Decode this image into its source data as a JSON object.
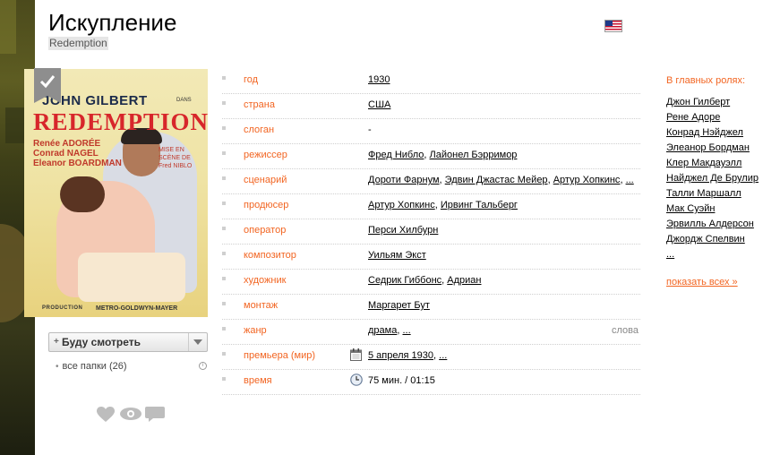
{
  "film": {
    "title": "Искупление",
    "original_title": "Redemption",
    "flag_icon": "us-flag-icon"
  },
  "poster": {
    "john": "JOHN GILBERT",
    "dans": "DANS",
    "title": "REDEMPTION",
    "cast_lines": [
      "Renée  ADORÉE",
      "Conrad  NAGEL",
      "Eleanor BOARDMAN"
    ],
    "mise": "MISE EN SCÈNE DE Fred NIBLO",
    "production": "PRODUCTION",
    "studio": "METRO-GOLDWYN-MAYER"
  },
  "watchlist": {
    "button_label": "Буду смотреть",
    "folders_label": "все папки (26)"
  },
  "info_rows": [
    {
      "label": "год",
      "values": [
        "1930"
      ]
    },
    {
      "label": "страна",
      "values": [
        "США"
      ]
    },
    {
      "label": "слоган",
      "values": [],
      "plain": "-"
    },
    {
      "label": "режиссер",
      "values": [
        "Фред Нибло",
        "Лайонел Бэрримор"
      ]
    },
    {
      "label": "сценарий",
      "values": [
        "Дороти Фарнум",
        "Эдвин Джастас Мейер",
        "Артур Хопкинс",
        "..."
      ]
    },
    {
      "label": "продюсер",
      "values": [
        "Артур Хопкинс",
        "Ирвинг Тальберг"
      ]
    },
    {
      "label": "оператор",
      "values": [
        "Перси Хилбурн"
      ]
    },
    {
      "label": "композитор",
      "values": [
        "Уильям Экст"
      ]
    },
    {
      "label": "художник",
      "values": [
        "Седрик Гиббонс",
        "Адриан"
      ]
    },
    {
      "label": "монтаж",
      "values": [
        "Маргарет Бут"
      ]
    },
    {
      "label": "жанр",
      "values": [
        "драма",
        "..."
      ],
      "extra": "слова"
    },
    {
      "label": "премьера (мир)",
      "values": [
        "5 апреля 1930",
        "..."
      ],
      "icon": "calendar-icon"
    },
    {
      "label": "время",
      "values": [],
      "plain": "75 мин. / 01:15",
      "icon": "clock-icon"
    }
  ],
  "cast": {
    "heading": "В главных ролях:",
    "actors": [
      "Джон Гилберт",
      "Рене Адоре",
      "Конрад Нэйджел",
      "Элеанор Бордман",
      "Клер Макдауэлл",
      "Найджел Де Брулир",
      "Талли Маршалл",
      "Мак Суэйн",
      "Эрвилль Алдерсон",
      "Джордж Спелвин",
      "..."
    ],
    "show_all": "показать всех »"
  },
  "colors": {
    "accent": "#f26522",
    "label": "#f26522",
    "muted": "#888888"
  }
}
